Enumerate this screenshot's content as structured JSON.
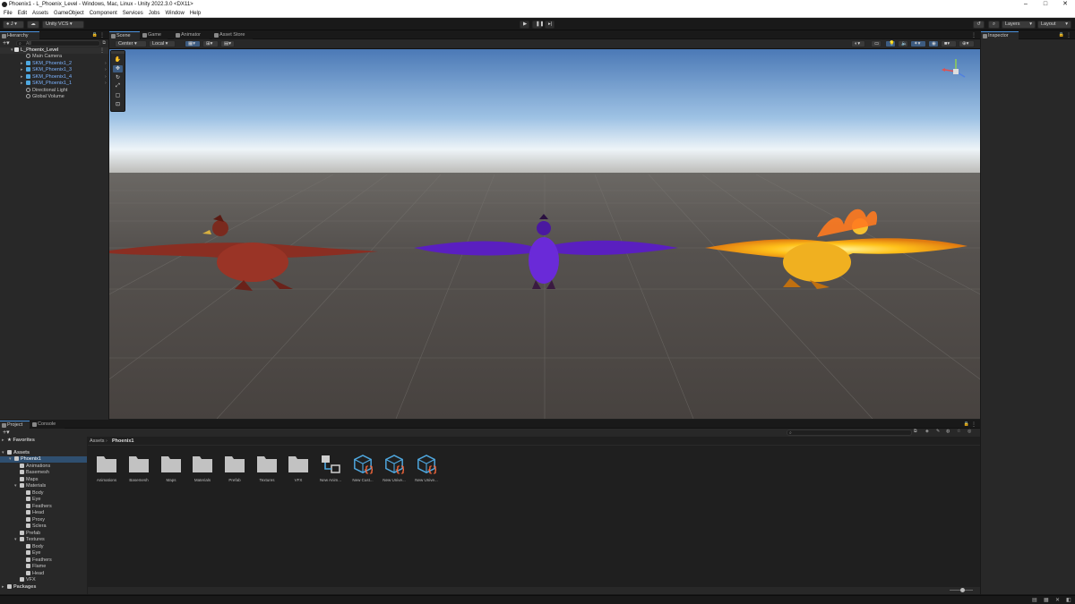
{
  "window": {
    "title": "Phoenix1 - L_Phoenix_Level - Windows, Mac, Linux - Unity 2022.3.0 <DX11>",
    "minimize": "‒",
    "maximize": "□",
    "close": "✕"
  },
  "menu": [
    "File",
    "Edit",
    "Assets",
    "GameObject",
    "Component",
    "Services",
    "Jobs",
    "Window",
    "Help"
  ],
  "toolbar": {
    "account": "J",
    "vcs": "Unity VCS",
    "layers": "Layers",
    "layout": "Layout"
  },
  "hierarchy": {
    "tab": "Hierarchy",
    "search_placeholder": "All",
    "scene": "L_Phoenix_Level",
    "items": [
      {
        "label": "Main Camera",
        "prefab": false
      },
      {
        "label": "SKM_Phoenix1_2",
        "prefab": true
      },
      {
        "label": "SKM_Phoenix1_3",
        "prefab": true
      },
      {
        "label": "SKM_Phoenix1_4",
        "prefab": true
      },
      {
        "label": "SKM_Phoenix1_1",
        "prefab": true
      },
      {
        "label": "Directional Light",
        "prefab": false
      },
      {
        "label": "Global Volume",
        "prefab": false
      }
    ]
  },
  "scene_tabs": [
    "Scene",
    "Game",
    "Animator",
    "Asset Store"
  ],
  "scene_toolbar": {
    "pivot": "Center",
    "space": "Local"
  },
  "inspector": {
    "tab": "Inspector"
  },
  "bottom_tabs": [
    "Project",
    "Console"
  ],
  "project": {
    "favorites": "Favorites",
    "assets": "Assets",
    "packages": "Packages",
    "tree": [
      {
        "label": "Phoenix1",
        "depth": 1
      },
      {
        "label": "Animations",
        "depth": 2
      },
      {
        "label": "Basemesh",
        "depth": 2
      },
      {
        "label": "Maps",
        "depth": 2
      },
      {
        "label": "Materials",
        "depth": 2
      },
      {
        "label": "Body",
        "depth": 3
      },
      {
        "label": "Eye",
        "depth": 3
      },
      {
        "label": "Feathers",
        "depth": 3
      },
      {
        "label": "Head",
        "depth": 3
      },
      {
        "label": "Proxy",
        "depth": 3
      },
      {
        "label": "Sclera",
        "depth": 3
      },
      {
        "label": "Prefab",
        "depth": 2
      },
      {
        "label": "Textures",
        "depth": 2
      },
      {
        "label": "Body",
        "depth": 3
      },
      {
        "label": "Eye",
        "depth": 3
      },
      {
        "label": "Feathers",
        "depth": 3
      },
      {
        "label": "Flame",
        "depth": 3
      },
      {
        "label": "Head",
        "depth": 3
      },
      {
        "label": "VFX",
        "depth": 2
      }
    ],
    "breadcrumb": [
      "Assets",
      "Phoenix1"
    ],
    "assets_grid": [
      {
        "label": "Animations",
        "kind": "folder"
      },
      {
        "label": "Basemesh",
        "kind": "folder"
      },
      {
        "label": "Maps",
        "kind": "folder"
      },
      {
        "label": "Materials",
        "kind": "folder"
      },
      {
        "label": "Prefab",
        "kind": "folder"
      },
      {
        "label": "Textures",
        "kind": "folder"
      },
      {
        "label": "VFX",
        "kind": "folder"
      },
      {
        "label": "New Anim...",
        "kind": "animator"
      },
      {
        "label": "New Cust...",
        "kind": "shader"
      },
      {
        "label": "New Unive...",
        "kind": "shader"
      },
      {
        "label": "New Unive...",
        "kind": "shader"
      }
    ]
  },
  "colors": {
    "accent": "#4a90d9",
    "prefab": "#7cb3ff",
    "shader_cube": "#4fa8e0",
    "shader_braces": "#ff6a3d"
  }
}
